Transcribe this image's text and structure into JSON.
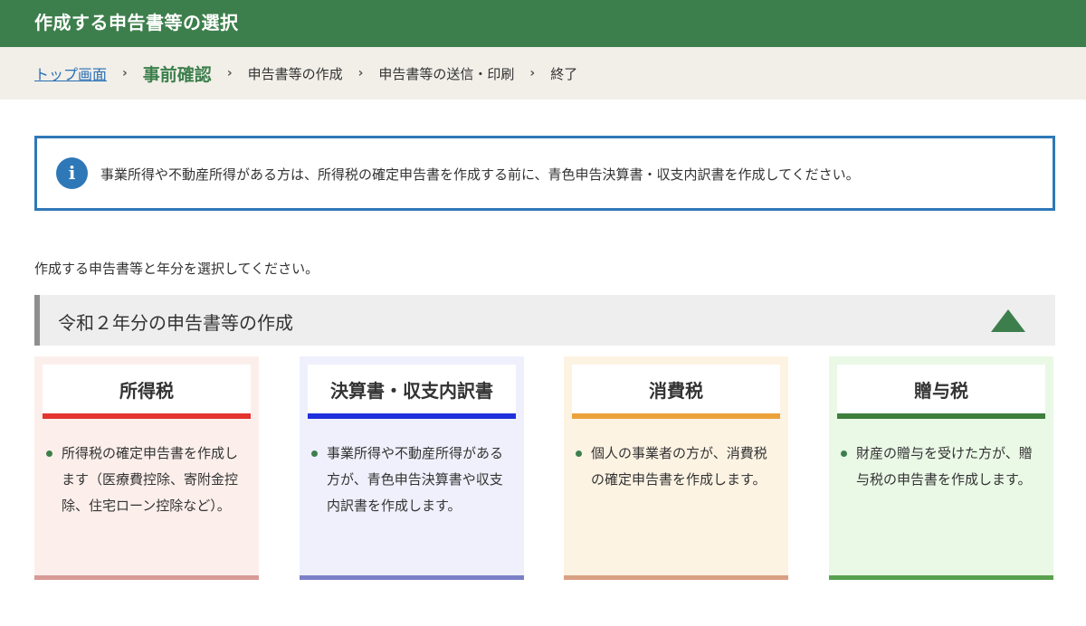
{
  "header": {
    "title": "作成する申告書等の選択"
  },
  "breadcrumb": {
    "top_link": "トップ画面",
    "separator": "›",
    "current": "事前確認",
    "step3": "申告書等の作成",
    "step4": "申告書等の送信・印刷",
    "step5": "終了"
  },
  "info": {
    "icon": "info-icon",
    "icon_glyph": "i",
    "text": "事業所得や不動産所得がある方は、所得税の確定申告書を作成する前に、青色申告決算書・収支内訳書を作成してください。"
  },
  "instruction": "作成する申告書等と年分を選択してください。",
  "section": {
    "title": "令和２年分の申告書等の作成",
    "collapse_icon": "triangle-up-icon"
  },
  "cards": [
    {
      "title": "所得税",
      "description": "所得税の確定申告書を作成します（医療費控除、寄附金控除、住宅ローン控除など）。",
      "bg": "#fcefeb",
      "underline": "#e3342f",
      "bottom": "#d89a96"
    },
    {
      "title": "決算書・収支内訳書",
      "description": "事業所得や不動産所得がある方が、青色申告決算書や収支内訳書を作成します。",
      "bg": "#eff0fc",
      "underline": "#1f30dc",
      "bottom": "#7b80c8"
    },
    {
      "title": "消費税",
      "description": "個人の事業者の方が、消費税の確定申告書を作成します。",
      "bg": "#fdf3e3",
      "underline": "#eba23a",
      "bottom": "#d9a083"
    },
    {
      "title": "贈与税",
      "description": "財産の贈与を受けた方が、贈与税の申告書を作成します。",
      "bg": "#eaf8e6",
      "underline": "#3d7f3b",
      "bottom": "#58a14e"
    }
  ],
  "colors": {
    "header_bg": "#3d7f4c",
    "breadcrumb_bg": "#f1efe8",
    "link": "#2a6fb5",
    "info_border": "#2f78b8"
  }
}
